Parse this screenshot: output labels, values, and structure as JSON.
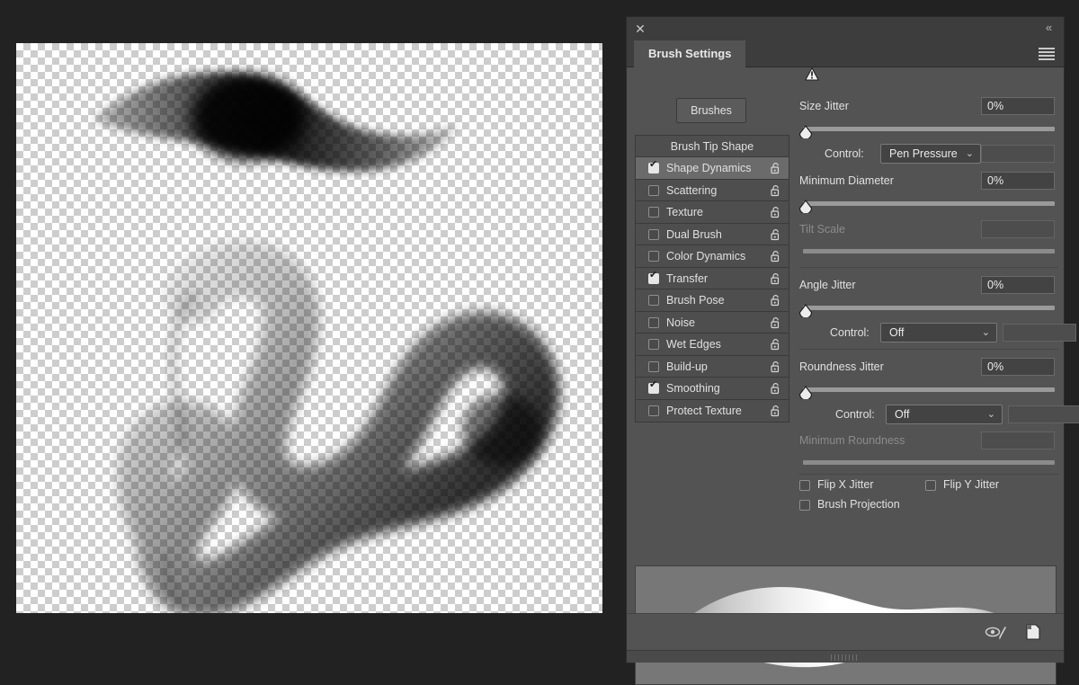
{
  "app": {
    "background_color": "#222222",
    "panel_background": "#535353"
  },
  "canvas": {
    "name": "document-canvas",
    "transparency_checkerboard": true,
    "checker_size_px": 8,
    "strokes": [
      {
        "name": "brush-dab-stroke",
        "description": "single tapered brush dab, dark center"
      },
      {
        "name": "serpentine-stroke",
        "description": "tapered S-curve stroke, light to dark"
      }
    ]
  },
  "panel": {
    "title": "Brush Settings",
    "close_icon": "close-icon",
    "collapse_icon": "double-chevron-left-icon",
    "menu_icon": "hamburger-menu-icon",
    "brushes_button": "Brushes"
  },
  "options_list": {
    "header": "Brush Tip Shape",
    "items": [
      {
        "label": "Shape Dynamics",
        "checked": true,
        "selected": true
      },
      {
        "label": "Scattering",
        "checked": false,
        "selected": false
      },
      {
        "label": "Texture",
        "checked": false,
        "selected": false
      },
      {
        "label": "Dual Brush",
        "checked": false,
        "selected": false
      },
      {
        "label": "Color Dynamics",
        "checked": false,
        "selected": false
      },
      {
        "label": "Transfer",
        "checked": true,
        "selected": false
      },
      {
        "label": "Brush Pose",
        "checked": false,
        "selected": false
      },
      {
        "label": "Noise",
        "checked": false,
        "selected": false
      },
      {
        "label": "Wet Edges",
        "checked": false,
        "selected": false
      },
      {
        "label": "Build-up",
        "checked": false,
        "selected": false
      },
      {
        "label": "Smoothing",
        "checked": true,
        "selected": false
      },
      {
        "label": "Protect Texture",
        "checked": false,
        "selected": false
      }
    ],
    "lock_icon": "unlocked-padlock-icon"
  },
  "controls": {
    "size_jitter": {
      "label": "Size Jitter",
      "value": "0%",
      "slider_position_pct": 0
    },
    "size_control": {
      "label": "Control:",
      "selected": "Pen Pressure",
      "warning_icon": "warning-triangle-icon",
      "aux_value": ""
    },
    "minimum_diameter": {
      "label": "Minimum Diameter",
      "value": "0%",
      "slider_position_pct": 0
    },
    "tilt_scale": {
      "label": "Tilt Scale",
      "value": "",
      "disabled": true
    },
    "angle_jitter": {
      "label": "Angle Jitter",
      "value": "0%",
      "slider_position_pct": 0
    },
    "angle_control": {
      "label": "Control:",
      "selected": "Off",
      "aux_value": ""
    },
    "roundness_jitter": {
      "label": "Roundness Jitter",
      "value": "0%",
      "slider_position_pct": 0
    },
    "roundness_control": {
      "label": "Control:",
      "selected": "Off",
      "aux_value": ""
    },
    "minimum_roundness": {
      "label": "Minimum Roundness",
      "value": "",
      "disabled": true
    },
    "flip_x_jitter": {
      "label": "Flip X Jitter",
      "checked": false
    },
    "flip_y_jitter": {
      "label": "Flip Y Jitter",
      "checked": false
    },
    "brush_projection": {
      "label": "Brush Projection",
      "checked": false
    }
  },
  "preview": {
    "name": "brush-stroke-preview",
    "background_color": "#777777",
    "stroke_color": "#ffffff"
  },
  "footer": {
    "toggle_live_tip_icon": "eye-brush-icon",
    "new_brush_icon": "new-brush-preset-icon",
    "resize_grip": "panel-resize-grip"
  }
}
